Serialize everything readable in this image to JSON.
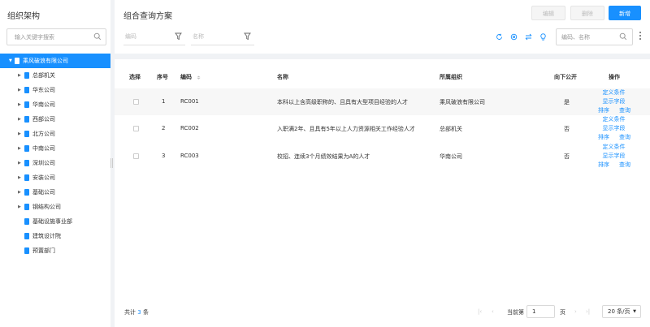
{
  "sidebar": {
    "title": "组织架构",
    "search_placeholder": "输入关键字搜索",
    "tree": [
      {
        "label": "乘风破浪有限公司",
        "selected": true,
        "expanded": true
      },
      {
        "label": "总部机关",
        "has_children": true
      },
      {
        "label": "华东公司",
        "has_children": true
      },
      {
        "label": "华南公司",
        "has_children": true
      },
      {
        "label": "西部公司",
        "has_children": true
      },
      {
        "label": "北方公司",
        "has_children": true
      },
      {
        "label": "中南公司",
        "has_children": true
      },
      {
        "label": "深圳公司",
        "has_children": true
      },
      {
        "label": "安装公司",
        "has_children": true
      },
      {
        "label": "基础公司",
        "has_children": true
      },
      {
        "label": "钢结构公司",
        "has_children": true
      },
      {
        "label": "基础设施事业部",
        "has_children": false
      },
      {
        "label": "建筑设计院",
        "has_children": false
      },
      {
        "label": "预置部门",
        "has_children": false
      }
    ]
  },
  "header": {
    "title": "组合查询方案",
    "edit_label": "编辑",
    "delete_label": "删除",
    "add_label": "新增",
    "filter_code_placeholder": "编码",
    "filter_name_placeholder": "名称",
    "search_placeholder": "编码、名称"
  },
  "table": {
    "headers": {
      "select": "选择",
      "index": "序号",
      "code": "编码",
      "name": "名称",
      "org": "所属组织",
      "public": "向下公开",
      "ops": "操作"
    },
    "rows": [
      {
        "index": "1",
        "code": "RC001",
        "name": "本科以上含高级职称的、且具有大型项目经验的人才",
        "org": "乘风破浪有限公司",
        "public": "是"
      },
      {
        "index": "2",
        "code": "RC002",
        "name": "入职满2年、且具有5年以上人力资源相关工作经验人才",
        "org": "总部机关",
        "public": "否"
      },
      {
        "index": "3",
        "code": "RC003",
        "name": "校招、连续3个月绩效结果为A的人才",
        "org": "华南公司",
        "public": "否"
      }
    ],
    "ops": {
      "define": "定义条件",
      "display": "显示字段",
      "sort": "排序",
      "query": "查询"
    }
  },
  "footer": {
    "total_prefix": "共计",
    "total_count": "3",
    "total_suffix": "条",
    "page_prefix": "当前第",
    "page_value": "1",
    "page_suffix": "页",
    "page_size": "20 条/页"
  },
  "colors": {
    "accent": "#1890ff",
    "alt_row": "#f7f7f7",
    "background": "#f0f2f5"
  }
}
